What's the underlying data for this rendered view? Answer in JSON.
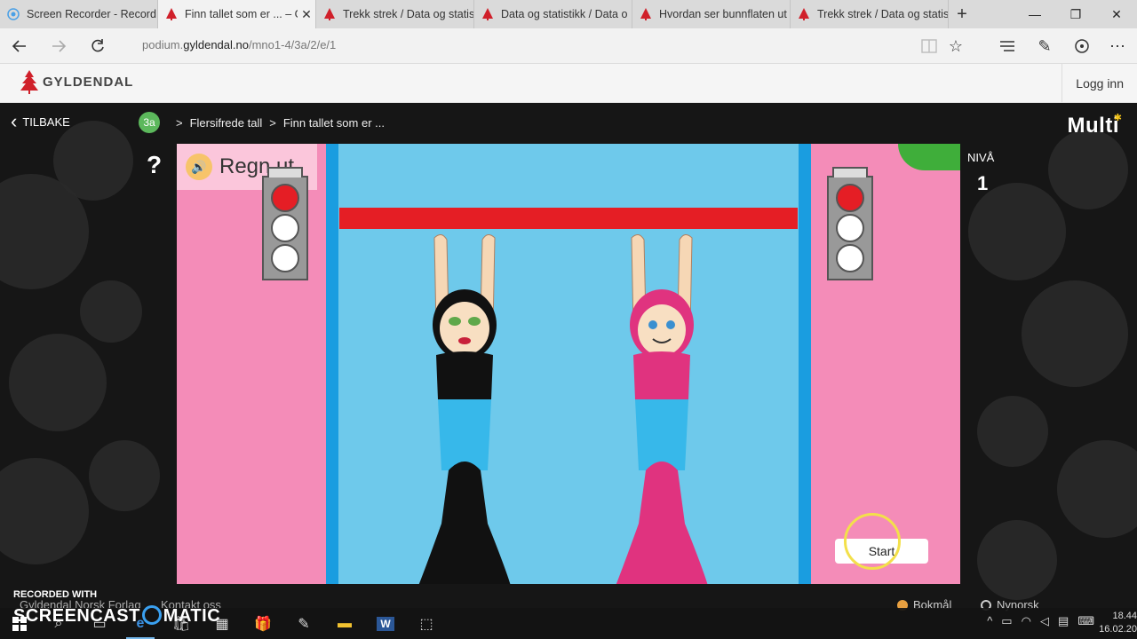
{
  "browser": {
    "tabs": [
      {
        "title": "Screen Recorder - Record",
        "favicon": "screen-recorder-icon",
        "active": false
      },
      {
        "title": "Finn tallet som er ... – G",
        "favicon": "gyldendal-tree-icon",
        "active": true
      },
      {
        "title": "Trekk strek / Data og statis",
        "favicon": "gyldendal-tree-icon",
        "active": false
      },
      {
        "title": "Data og statistikk / Data o",
        "favicon": "gyldendal-tree-icon",
        "active": false
      },
      {
        "title": "Hvordan ser bunnflaten ut",
        "favicon": "gyldendal-tree-icon",
        "active": false
      },
      {
        "title": "Trekk strek / Data og statis",
        "favicon": "gyldendal-tree-icon",
        "active": false
      }
    ],
    "new_tab": "+",
    "window_controls": {
      "minimize": "—",
      "restore": "❐",
      "close": "✕"
    },
    "url_prefix": "podium.",
    "url_domain": "gyldendal.no",
    "url_path": "/mno1-4/3a/2/e/1"
  },
  "site": {
    "logo_text": "GYLDENDAL",
    "login": "Logg inn"
  },
  "nav": {
    "back_label": "TILBAKE",
    "grade": "3a",
    "crumb_sep": ">",
    "crumbs": [
      "Flersifrede tall",
      "Finn tallet som er ..."
    ],
    "brand": "Multi"
  },
  "game": {
    "help": "?",
    "prompt": "Regn ut.",
    "level_label": "NIVÅ",
    "level": "1",
    "start_button": "Start",
    "colors": {
      "pink": "#f48cb8",
      "pool": "#6ec9eb",
      "pool_edge": "#1a9de0",
      "bar": "#e51e25"
    }
  },
  "footer": {
    "recorded_with": "RECORDED WITH",
    "screencast_a": "SCREENCAST",
    "screencast_b": "MATIC",
    "company": "Gyldendal Norsk Forlag",
    "contact": "Kontakt oss",
    "lang_bokmal": "Bokmål",
    "lang_nynorsk": "Nynorsk"
  },
  "taskbar": {
    "time": "18.44",
    "date": "16.02.20"
  }
}
